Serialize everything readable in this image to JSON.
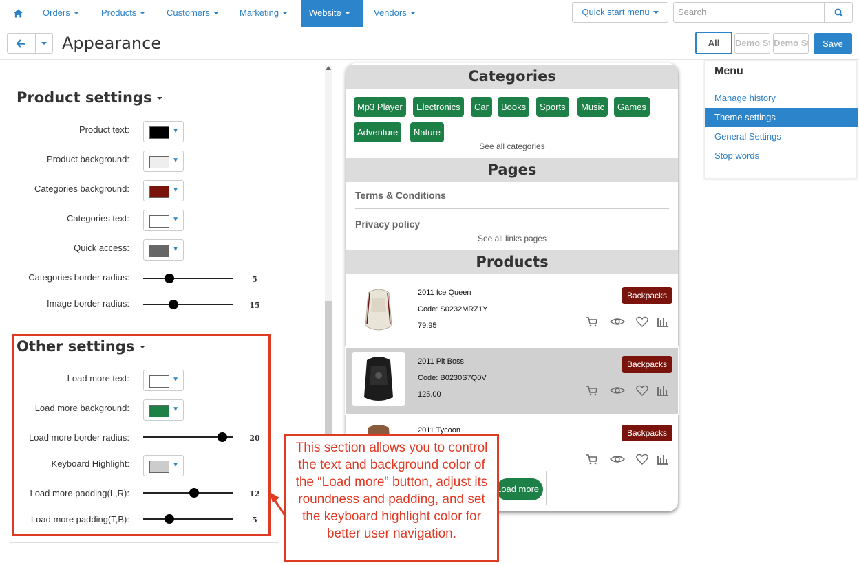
{
  "nav": {
    "items": [
      {
        "label": "Orders"
      },
      {
        "label": "Products"
      },
      {
        "label": "Customers"
      },
      {
        "label": "Marketing"
      },
      {
        "label": "Website"
      },
      {
        "label": "Vendors"
      }
    ],
    "quick_start_label": "Quick start menu",
    "search_placeholder": "Search"
  },
  "subbar": {
    "title": "Appearance",
    "all_label": "All",
    "store_labels": [
      "Demo Sto",
      "Demo Sto"
    ],
    "save_label": "Save"
  },
  "product_settings": {
    "title": "Product settings",
    "rows": [
      {
        "label": "Product text:",
        "color": "#000000"
      },
      {
        "label": "Product background:",
        "color": "#eeeeee"
      },
      {
        "label": "Categories background:",
        "color": "#7a130b"
      },
      {
        "label": "Categories text:",
        "color": "#ffffff"
      },
      {
        "label": "Quick access:",
        "color": "#666666"
      }
    ],
    "sliders": [
      {
        "label": "Categories border radius:",
        "value": "5",
        "level": 0.27
      },
      {
        "label": "Image border radius:",
        "value": "15",
        "level": 0.32
      }
    ]
  },
  "other_settings": {
    "title": "Other settings",
    "rows": [
      {
        "label": "Load more text:",
        "color": "#ffffff"
      },
      {
        "label": "Load more background:",
        "color": "#1d8147"
      }
    ],
    "slider_border": {
      "label": "Load more border radius:",
      "value": "20",
      "level": 0.93
    },
    "keyboard": {
      "label": "Keyboard Highlight:",
      "color": "#cccccc"
    },
    "sliders": [
      {
        "label": "Load more padding(L,R):",
        "value": "12",
        "level": 0.58
      },
      {
        "label": "Load more padding(T,B):",
        "value": "5",
        "level": 0.27
      }
    ]
  },
  "preview": {
    "categories_title": "Categories",
    "categories": [
      "Mp3 Player",
      "Electronics",
      "Car",
      "Books",
      "Sports",
      "Music",
      "Games",
      "Adventure",
      "Nature"
    ],
    "see_all_categories": "See all categories",
    "pages_title": "Pages",
    "pages": [
      "Terms & Conditions",
      "Privacy policy"
    ],
    "see_all_pages": "See all links pages",
    "products_title": "Products",
    "products": [
      {
        "name": "2011 Ice Queen",
        "code": "Code: S0232MRZ1Y",
        "price": "79.95",
        "badge": "Backpacks"
      },
      {
        "name": "2011 Pit Boss",
        "code": "Code: B0230S7Q0V",
        "price": "125.00",
        "badge": "Backpacks"
      },
      {
        "name": "2011 Tycoon",
        "code": "",
        "price": "",
        "badge": "Backpacks"
      }
    ],
    "load_more_label": "Load more"
  },
  "menu": {
    "title": "Menu",
    "items": [
      {
        "label": "Manage history"
      },
      {
        "label": "Theme settings"
      },
      {
        "label": "General Settings"
      },
      {
        "label": "Stop words"
      }
    ]
  },
  "callout_text": "This section allows you to control the text and background color of the “Load more” button, adjust its roundness and padding, and set the keyboard highlight color for better user navigation.",
  "colors": {
    "accent": "#2c84ca",
    "annotation": "#e03a25",
    "chip": "#1d8147",
    "badge": "#7a130b"
  }
}
